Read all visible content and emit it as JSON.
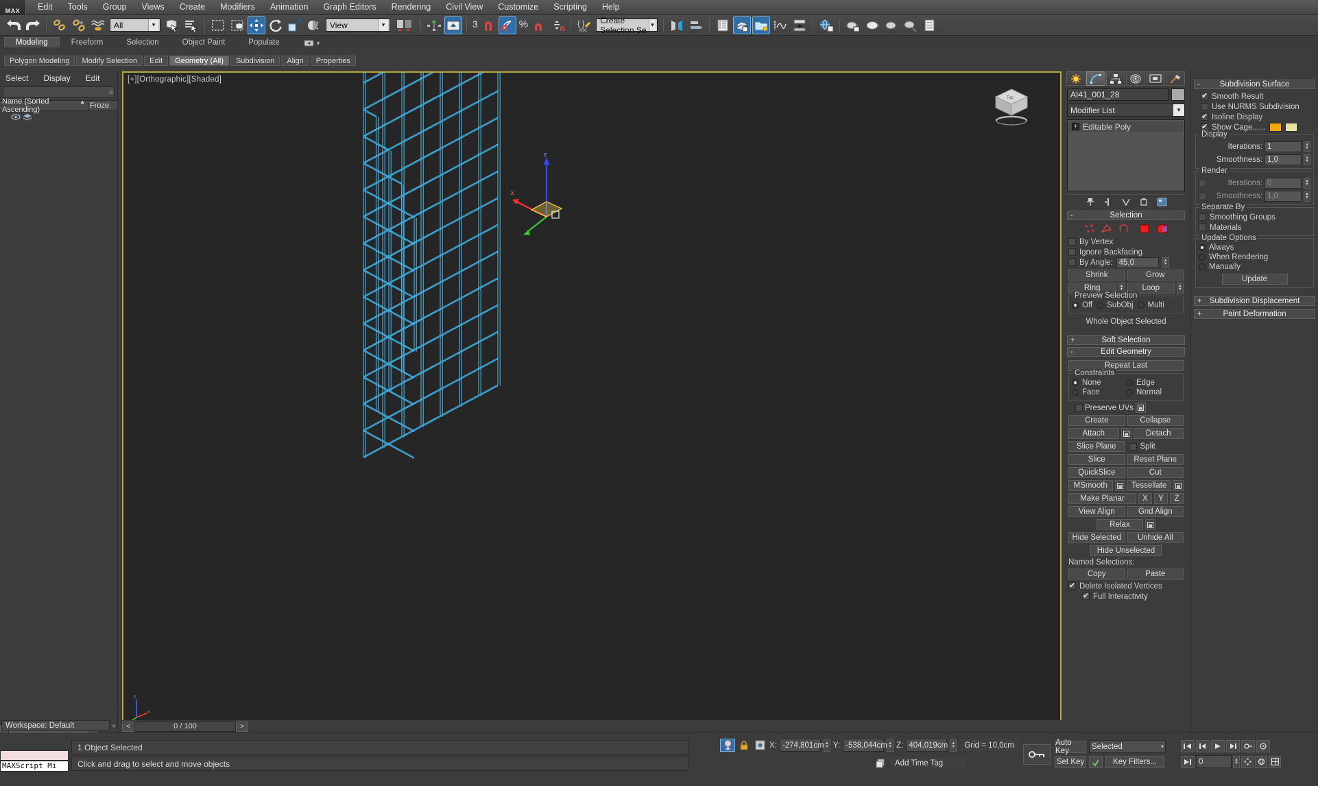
{
  "app": {
    "logo": "MAX"
  },
  "menubar": {
    "items": [
      "Edit",
      "Tools",
      "Group",
      "Views",
      "Create",
      "Modifiers",
      "Animation",
      "Graph Editors",
      "Rendering",
      "Civil View",
      "Customize",
      "Scripting",
      "Help"
    ]
  },
  "toolbar": {
    "selection_filter": "All",
    "reference_coord": "View",
    "named_selection_placeholder": "Create Selection Se",
    "angle_snap_value": "3",
    "icons": [
      "undo-icon",
      "redo-icon",
      "select-link-icon",
      "unlink-icon",
      "bind-space-warp-icon",
      "select-object-icon",
      "select-by-name-icon",
      "rectangle-select-region-icon",
      "window-crossing-icon",
      "select-and-move-icon",
      "select-and-rotate-icon",
      "select-and-scale-icon",
      "select-and-place-icon",
      "mirror-icon",
      "align-icon",
      "snaps-toggle-icon",
      "angle-snap-icon",
      "percent-snap-icon",
      "spinner-snap-icon",
      "named-selection-sets-icon",
      "mirror-geometry-icon",
      "align-tools-icon",
      "layer-explorer-icon",
      "curve-editor-icon",
      "schematic-view-icon",
      "material-editor-icon",
      "render-setup-icon",
      "rendered-frame-icon",
      "render-production-icon",
      "render-iterative-icon"
    ]
  },
  "ribbon": {
    "tabs": [
      "Modeling",
      "Freeform",
      "Selection",
      "Object Paint",
      "Populate"
    ],
    "active_tab": "Modeling",
    "sub_buttons": [
      "Polygon Modeling",
      "Modify Selection",
      "Edit",
      "Geometry (All)",
      "Subdivision",
      "Align",
      "Properties"
    ],
    "active_sub": "Geometry (All)"
  },
  "explorer": {
    "menu": [
      "Select",
      "Display",
      "Edit"
    ],
    "search_value": "",
    "col_name": "Name (Sorted Ascending)",
    "col_frozen": "Froze",
    "sort_arrow": "▲",
    "rows": []
  },
  "viewport": {
    "label": "[+][Orthographic][Shaded]",
    "axis_x": "x",
    "axis_y": "y",
    "axis_z": "z",
    "cube_label": "Top",
    "bg_color": "#262626",
    "mesh_color": "#3fb9ef",
    "border_color": "#b5a642"
  },
  "command_panel": {
    "tabs": [
      "create-tab",
      "modify-tab",
      "hierarchy-tab",
      "motion-tab",
      "display-tab",
      "utilities-tab"
    ],
    "active_tab_index": 1,
    "object_name": "AI41_001_28",
    "modifier_list_label": "Modifier List",
    "stack": [
      {
        "label": "Editable Poly",
        "expander": "+"
      }
    ],
    "stack_buttons": [
      "pin-stack-icon",
      "show-end-result-icon",
      "make-unique-icon",
      "remove-modifier-icon",
      "configure-sets-icon"
    ],
    "selection": {
      "title": "Selection",
      "collapse": "-",
      "sub_object_levels": [
        "vertex-icon",
        "edge-icon",
        "border-icon",
        "polygon-icon",
        "element-icon"
      ],
      "active_level_index": 3,
      "by_vertex": {
        "label": "By Vertex",
        "checked": false
      },
      "ignore_backfacing": {
        "label": "Ignore Backfacing",
        "checked": false
      },
      "by_angle": {
        "label": "By Angle:",
        "checked": false,
        "value": "45,0"
      },
      "shrink": "Shrink",
      "grow": "Grow",
      "ring": "Ring",
      "loop": "Loop",
      "preview_selection_label": "Preview Selection",
      "preview_options": [
        "Off",
        "SubObj",
        "Multi"
      ],
      "preview_selected": "Off",
      "status": "Whole Object Selected"
    },
    "soft_selection": {
      "title": "Soft Selection",
      "expander": "+"
    },
    "edit_geometry": {
      "title": "Edit Geometry",
      "collapse": "-",
      "repeat_last": "Repeat Last",
      "constraints_label": "Constraints",
      "constraints": [
        "None",
        "Edge",
        "Face",
        "Normal"
      ],
      "constraint_selected": "None",
      "preserve_uvs": {
        "label": "Preserve UVs",
        "checked": false
      },
      "create": "Create",
      "collapse_btn": "Collapse",
      "attach": "Attach",
      "detach": "Detach",
      "slice_plane": "Slice Plane",
      "split": {
        "label": "Split",
        "checked": false
      },
      "slice": "Slice",
      "reset_plane": "Reset Plane",
      "quickslice": "QuickSlice",
      "cut": "Cut",
      "msmooth": "MSmooth",
      "tessellate": "Tessellate",
      "make_planar": "Make Planar",
      "axis_x": "X",
      "axis_y": "Y",
      "axis_z": "Z",
      "view_align": "View Align",
      "grid_align": "Grid Align",
      "relax": "Relax",
      "hide_selected": "Hide Selected",
      "unhide_all": "Unhide All",
      "hide_unselected": "Hide Unselected",
      "named_selections_label": "Named Selections:",
      "copy": "Copy",
      "paste": "Paste",
      "delete_isolated_vertices": {
        "label": "Delete Isolated Vertices",
        "checked": true
      },
      "full_interactivity": {
        "label": "Full Interactivity",
        "checked": true
      }
    }
  },
  "right_panel": {
    "subdivision_surface": {
      "title": "Subdivision Surface",
      "collapse": "-",
      "smooth_result": {
        "label": "Smooth Result",
        "checked": true
      },
      "use_nurms": {
        "label": "Use NURMS Subdivision",
        "checked": false
      },
      "isoline_display": {
        "label": "Isoline Display",
        "checked": true
      },
      "show_cage": {
        "label": "Show Cage......",
        "checked": true,
        "color1": "#f5a800",
        "color2": "#e6e6a0"
      },
      "display_label": "Display",
      "display_iterations": {
        "label": "Iterations:",
        "value": "1"
      },
      "display_smoothness": {
        "label": "Smoothness:",
        "value": "1,0"
      },
      "render_label": "Render",
      "render_iterations": {
        "label": "Iterations:",
        "value": "0",
        "checked": false
      },
      "render_smoothness": {
        "label": "Smoothness:",
        "value": "1,0",
        "checked": false
      },
      "separate_by_label": "Separate By",
      "smoothing_groups": {
        "label": "Smoothing Groups",
        "checked": false
      },
      "materials": {
        "label": "Materials",
        "checked": false
      },
      "update_options_label": "Update Options",
      "update_options": [
        "Always",
        "When Rendering",
        "Manually"
      ],
      "update_selected": "Always",
      "update_button": "Update"
    },
    "subdivision_displacement": {
      "title": "Subdivision Displacement",
      "expander": "+"
    },
    "paint_deformation": {
      "title": "Paint Deformation",
      "expander": "+"
    }
  },
  "timeline": {
    "prev": "<",
    "next": ">",
    "frame": "0 / 100"
  },
  "workspace": {
    "label": "Workspace: Default",
    "chevron": "»"
  },
  "status": {
    "maxscript_label": "MAXScript Mi",
    "selection_status": "1 Object Selected",
    "prompt": "Click and drag to select and move objects",
    "x_label": "X:",
    "x_value": "-274,801cm",
    "y_label": "Y:",
    "y_value": "-538,044cm",
    "z_label": "Z:",
    "z_value": "404,019cm",
    "grid": "Grid = 10,0cm",
    "add_time_tag": "Add Time Tag",
    "auto_key": "Auto Key",
    "set_key": "Set Key",
    "key_mode": "Selected",
    "key_filters": "Key Filters...",
    "key_field": "0"
  }
}
